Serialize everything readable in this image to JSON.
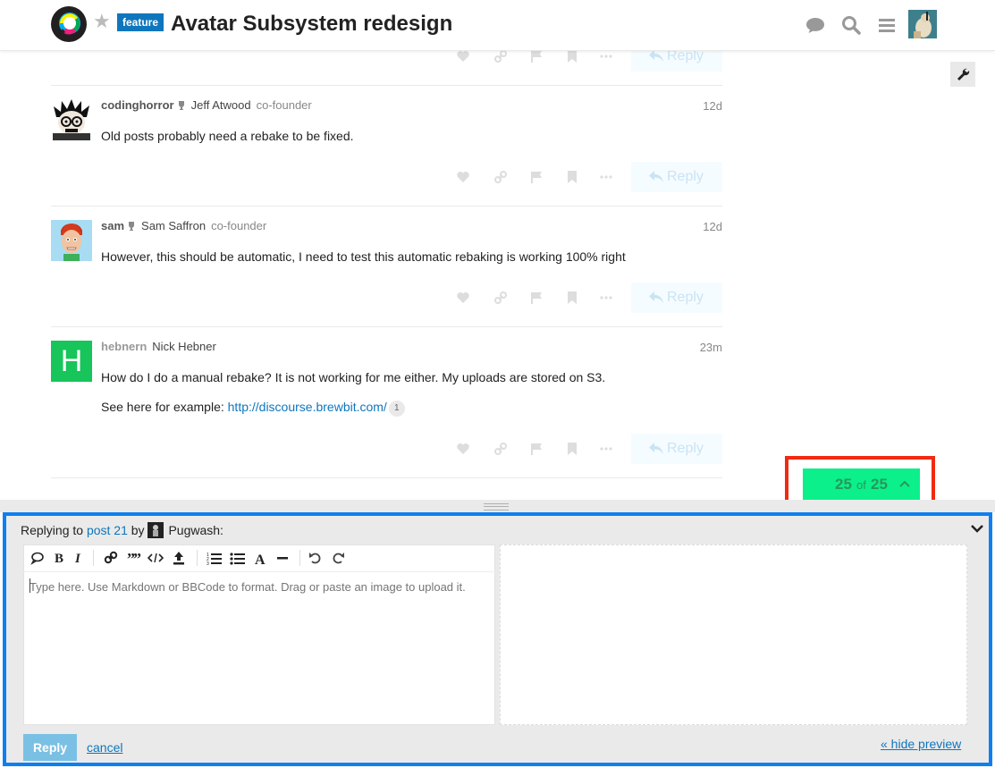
{
  "header": {
    "category_badge": "feature",
    "topic_title": "Avatar Subsystem redesign",
    "icons": [
      "logo-icon",
      "star-icon",
      "chat-icon",
      "search-icon",
      "hamburger-icon",
      "user-avatar"
    ]
  },
  "posts": [
    {
      "username": "codinghorror",
      "full_name": "Jeff Atwood",
      "user_title": "co-founder",
      "date": "12d",
      "body": [
        "Old posts probably need a rebake to be fixed."
      ]
    },
    {
      "username": "sam",
      "full_name": "Sam Saffron",
      "user_title": "co-founder",
      "date": "12d",
      "body": [
        "However, this should be automatic, I need to test this automatic rebaking is working 100% right"
      ]
    },
    {
      "username": "hebnern",
      "full_name": "Nick Hebner",
      "user_title": "",
      "date": "23m",
      "avatar_letter": "H",
      "body": [
        "How do I do a manual rebake? It is not working for me either. My uploads are stored on S3."
      ],
      "link_prefix": "See here for example: ",
      "link_text": "http://discourse.brewbit.com/",
      "link_clicks": "1"
    }
  ],
  "post_actions": {
    "reply_label": "Reply",
    "icons": [
      "like-icon",
      "link-icon",
      "flag-icon",
      "bookmark-icon",
      "more-icon"
    ]
  },
  "progress": {
    "current": "25",
    "of": "of",
    "total": "25",
    "fraction": 1.0
  },
  "composer": {
    "replying_to_prefix": "Replying to",
    "post_link": "post 21",
    "by": "by",
    "reply_user": "Pugwash:",
    "placeholder": "Type here. Use Markdown or BBCode to format. Drag or paste an image to upload it.",
    "submit_label": "Reply",
    "cancel_label": "cancel",
    "hide_preview_label": "« hide preview"
  },
  "colors": {
    "brand_blue": "#0e76bd",
    "progress_green": "#0bf08a",
    "highlight_red": "#f02a11",
    "highlight_blue": "#0e7ff0",
    "hebnern_avatar": "#17c55a"
  }
}
